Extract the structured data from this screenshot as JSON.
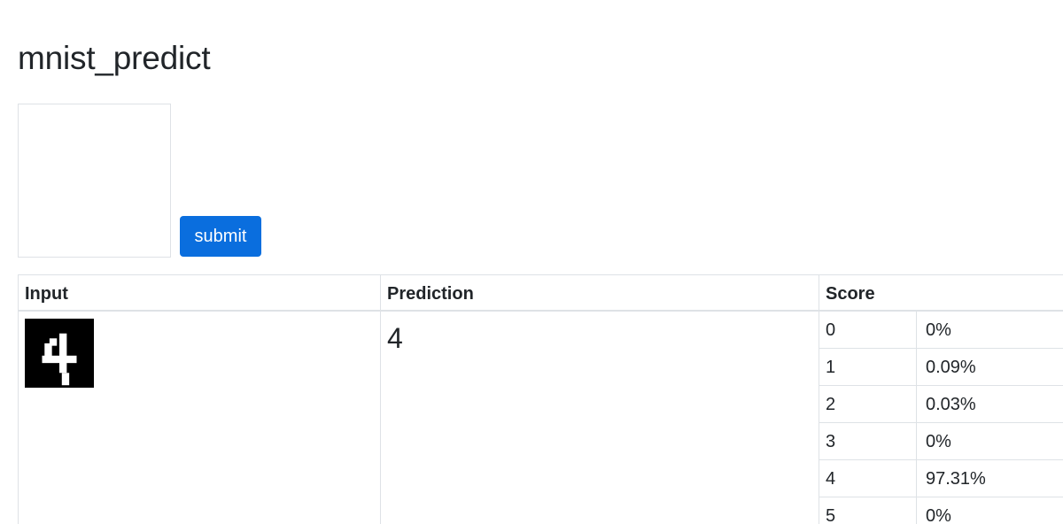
{
  "title": "mnist_predict",
  "submit_label": "submit",
  "table": {
    "headers": [
      "Input",
      "Prediction",
      "Score"
    ],
    "prediction": "4",
    "scores": [
      {
        "digit": "0",
        "value": "0%"
      },
      {
        "digit": "1",
        "value": "0.09%"
      },
      {
        "digit": "2",
        "value": "0.03%"
      },
      {
        "digit": "3",
        "value": "0%"
      },
      {
        "digit": "4",
        "value": "97.31%"
      },
      {
        "digit": "5",
        "value": "0%"
      }
    ]
  }
}
